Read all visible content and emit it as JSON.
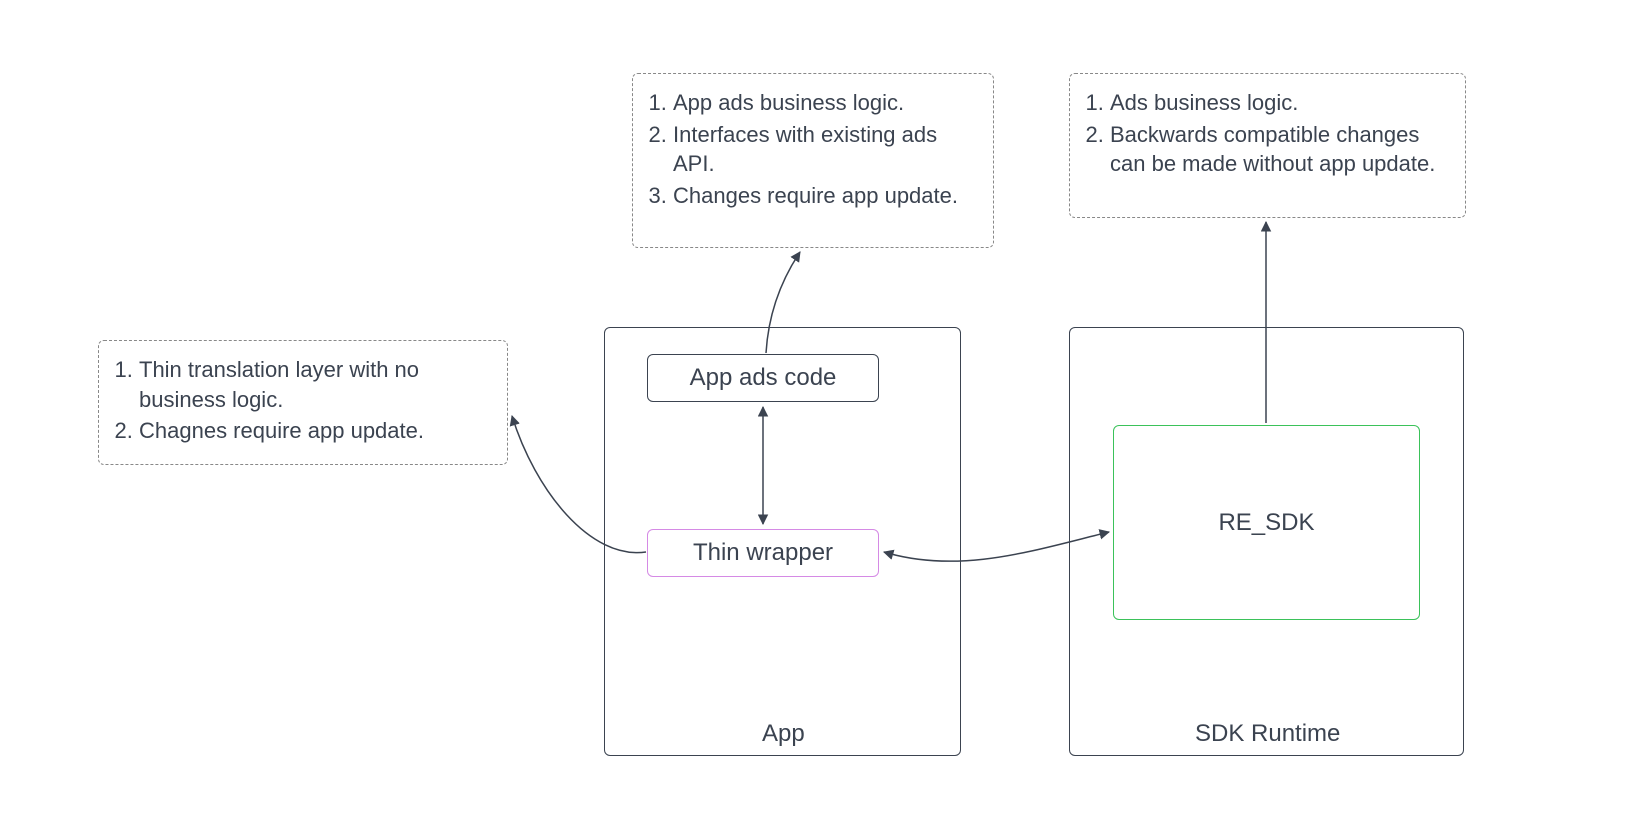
{
  "annotations": {
    "thinWrapper": {
      "items": [
        "Thin translation layer with no business logic.",
        "Chagnes require app update."
      ]
    },
    "appAdsCode": {
      "items": [
        "App ads business logic.",
        "Interfaces with existing ads API.",
        "Changes require app update."
      ]
    },
    "reSdk": {
      "items": [
        "Ads business logic.",
        "Backwards compatible changes can be made without app update."
      ]
    }
  },
  "containers": {
    "app": {
      "label": "App"
    },
    "sdkRuntime": {
      "label": "SDK Runtime"
    }
  },
  "nodes": {
    "appAdsCode": {
      "label": "App ads code"
    },
    "thinWrapper": {
      "label": "Thin wrapper"
    },
    "reSdk": {
      "label": "RE_SDK"
    }
  }
}
